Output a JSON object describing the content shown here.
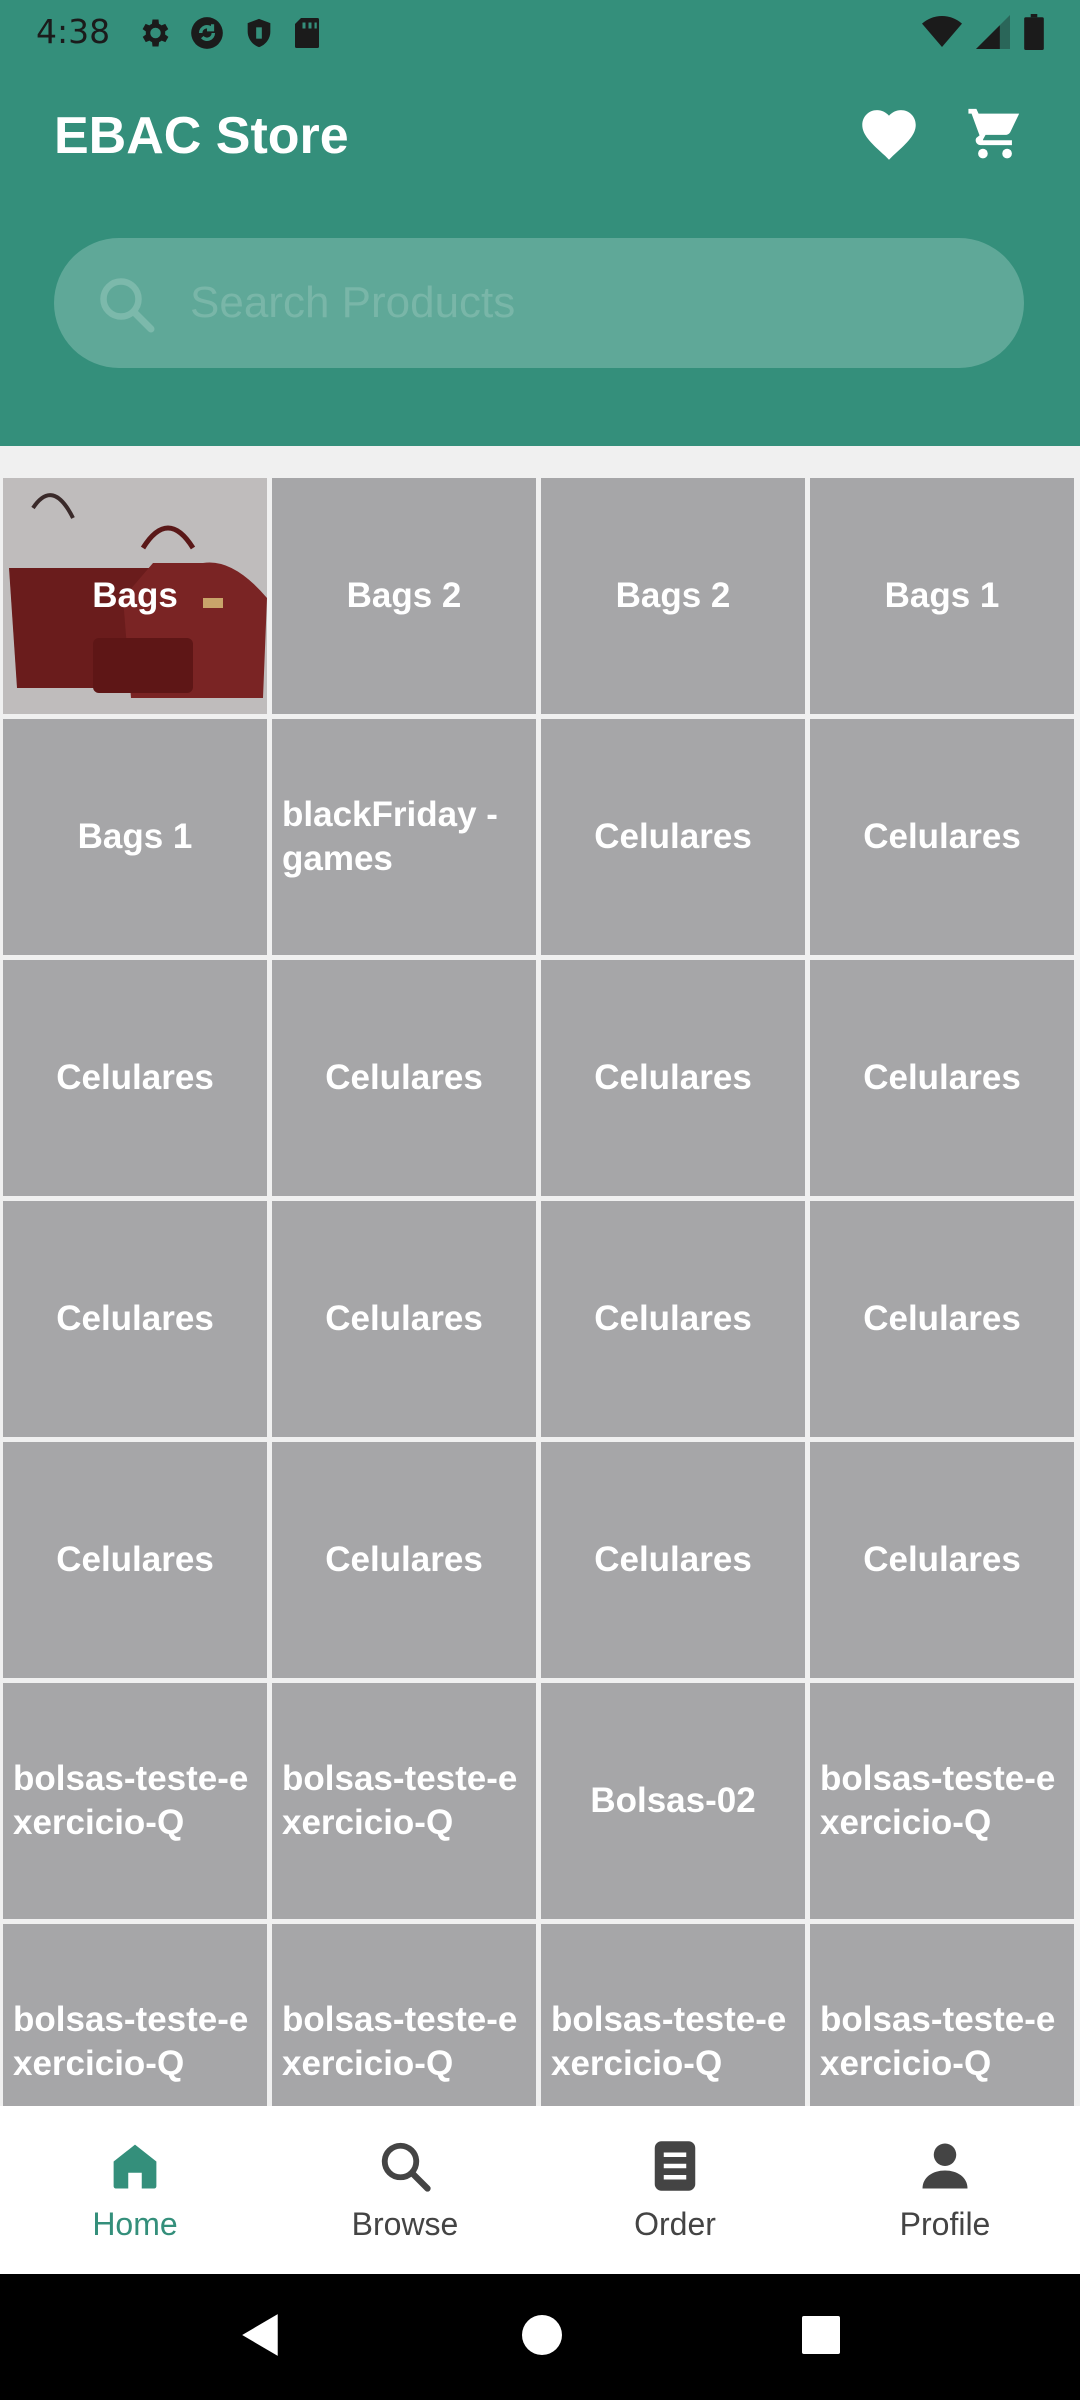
{
  "status_bar": {
    "time": "4:38",
    "left_icons": [
      "gear-icon",
      "sync-icon",
      "shield-icon",
      "sd-card-icon"
    ],
    "right_icons": [
      "wifi-icon",
      "signal-icon",
      "battery-icon"
    ]
  },
  "header": {
    "title": "EBAC Store",
    "favorites_icon": "heart-icon",
    "cart_icon": "cart-icon"
  },
  "search": {
    "placeholder": "Search Products",
    "value": ""
  },
  "categories": [
    "Bags",
    "Bags 2",
    "Bags 2",
    "Bags 1",
    "Bags 1",
    "blackFriday - games",
    "Celulares",
    "Celulares",
    "Celulares",
    "Celulares",
    "Celulares",
    "Celulares",
    "Celulares",
    "Celulares",
    "Celulares",
    "Celulares",
    "Celulares",
    "Celulares",
    "Celulares",
    "Celulares",
    "bolsas-teste-exercicio-Q",
    "bolsas-teste-exercicio-Q",
    "Bolsas-02",
    "bolsas-teste-exercicio-Q",
    "bolsas-teste-exercicio-Q",
    "bolsas-teste-exercicio-Q",
    "bolsas-teste-exercicio-Q",
    "bolsas-teste-exercicio-Q"
  ],
  "bottom_nav": {
    "active": "Home",
    "items": [
      {
        "label": "Home",
        "icon": "home-icon"
      },
      {
        "label": "Browse",
        "icon": "search-icon"
      },
      {
        "label": "Order",
        "icon": "order-icon"
      },
      {
        "label": "Profile",
        "icon": "profile-icon"
      }
    ]
  },
  "colors": {
    "primary": "#348f7b",
    "tile": "#a6a6a8",
    "active_nav": "#348f7b"
  }
}
